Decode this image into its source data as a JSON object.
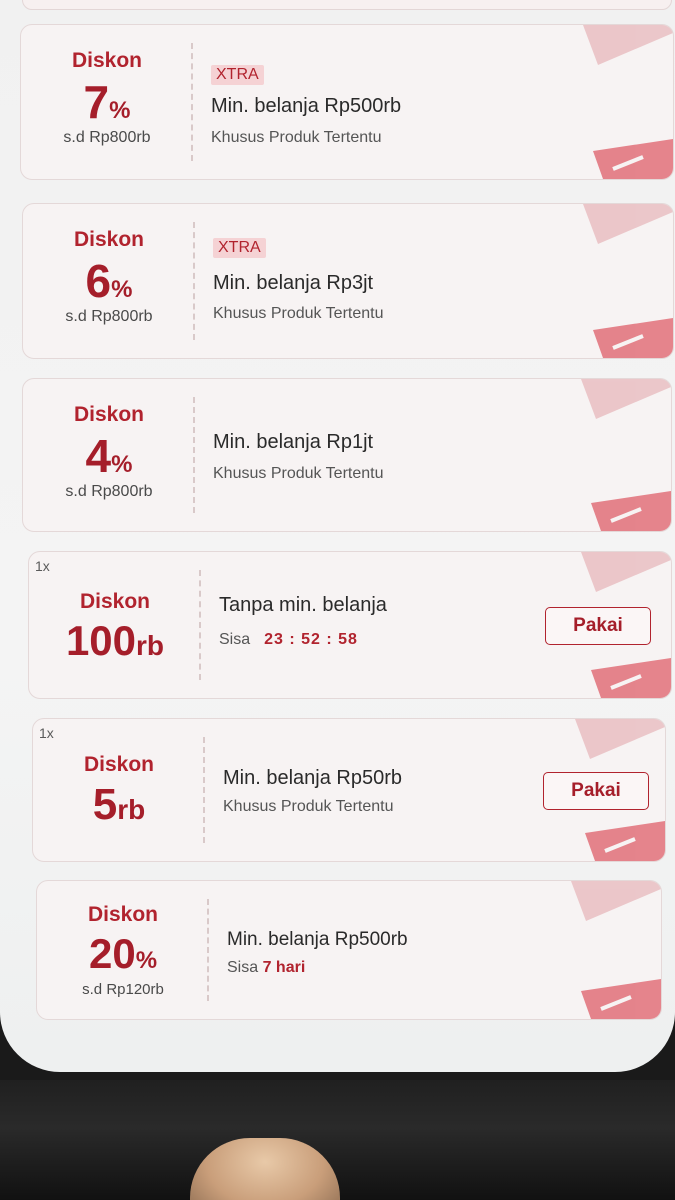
{
  "coupons": [
    {
      "badge": "",
      "label": "Diskon",
      "amount": "7",
      "unit": "%",
      "cap": "s.d Rp800rb",
      "tag": "XTRA",
      "title": "Min. belanja Rp500rb",
      "subtitle": "Khusus Produk Tertentu",
      "button": ""
    },
    {
      "badge": "",
      "label": "Diskon",
      "amount": "6",
      "unit": "%",
      "cap": "s.d Rp800rb",
      "tag": "XTRA",
      "title": "Min. belanja Rp3jt",
      "subtitle": "Khusus Produk Tertentu",
      "button": ""
    },
    {
      "badge": "",
      "label": "Diskon",
      "amount": "4",
      "unit": "%",
      "cap": "s.d Rp800rb",
      "tag": "",
      "title": "Min. belanja Rp1jt",
      "subtitle": "Khusus Produk Tertentu",
      "button": ""
    },
    {
      "badge": "1x",
      "label": "Diskon",
      "amount": "100",
      "unit": "rb",
      "cap": "",
      "tag": "",
      "title": "Tanpa min. belanja",
      "subtitle_prefix": "Sisa",
      "timer": "23 : 52 : 58",
      "button": "Pakai"
    },
    {
      "badge": "1x",
      "label": "Diskon",
      "amount": "5",
      "unit": "rb",
      "cap": "",
      "tag": "",
      "title": "Min. belanja Rp50rb",
      "subtitle": "Khusus Produk Tertentu",
      "button": "Pakai"
    },
    {
      "badge": "",
      "label": "Diskon",
      "amount": "20",
      "unit": "%",
      "cap": "s.d Rp120rb",
      "tag": "",
      "title": "Min. belanja Rp500rb",
      "subtitle_prefix": "Sisa",
      "subtitle_highlight": "7 hari",
      "button": ""
    }
  ],
  "colors": {
    "accent": "#b1232e",
    "card_bg": "#f7f3f3",
    "tag_bg": "#f5d2d4"
  },
  "icons": {
    "decoration": "ticket-stripe-icon"
  }
}
